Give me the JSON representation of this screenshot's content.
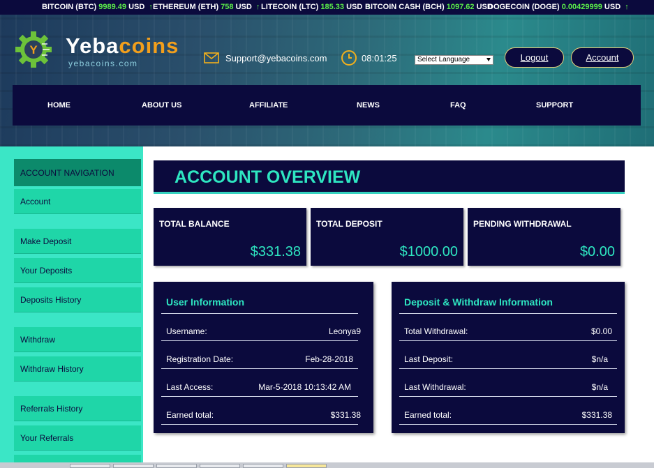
{
  "ticker": [
    {
      "label": "BITCOIN (BTC)",
      "price": "9989.49",
      "unit": "USD",
      "arrow": "↑"
    },
    {
      "label": "ETHEREUM (ETH)",
      "price": "758",
      "unit": "USD",
      "arrow": "↑"
    },
    {
      "label": "LITECOIN (LTC)",
      "price": "185.33",
      "unit": "USD",
      "arrow": "↑"
    },
    {
      "label": "BITCOIN CASH (BCH)",
      "price": "1097.62",
      "unit": "USD",
      "arrow": "↑"
    },
    {
      "label": "DOGECOIN (DOGE)",
      "price": "0.00429999",
      "unit": "USD",
      "arrow": "↑"
    }
  ],
  "header": {
    "logo_name_1": "Yeba",
    "logo_name_2": "coins",
    "logo_sub": "yebacoins.com",
    "support_email": "Support@yebacoins.com",
    "clock": "08:01:25",
    "language_select": "Select Language",
    "logout_label": "Logout",
    "account_label": "Account"
  },
  "nav": [
    "HOME",
    "ABOUT US",
    "AFFILIATE",
    "NEWS",
    "FAQ",
    "SUPPORT"
  ],
  "sidebar": {
    "heading": "ACCOUNT NAVIGATION",
    "items": [
      "Account",
      "Make Deposit",
      "Your Deposits",
      "Deposits History",
      "Withdraw",
      "Withdraw History",
      "Referrals History",
      "Your Referrals"
    ]
  },
  "main": {
    "title": "ACCOUNT OVERVIEW",
    "stats": [
      {
        "label": "TOTAL BALANCE",
        "value": "$331.38"
      },
      {
        "label": "TOTAL DEPOSIT",
        "value": "$1000.00"
      },
      {
        "label": "PENDING WITHDRAWAL",
        "value": "$0.00"
      }
    ],
    "user_info": {
      "title": "User Information",
      "rows": [
        {
          "k": "Username:",
          "v": "Leonya9"
        },
        {
          "k": "Registration Date:",
          "v": "Feb-28-2018"
        },
        {
          "k": "Last Access:",
          "v": "Mar-5-2018 10:13:42 AM"
        },
        {
          "k": "Earned total:",
          "v": "$331.38"
        }
      ]
    },
    "dw_info": {
      "title": "Deposit & Withdraw Information",
      "rows": [
        {
          "k": "Total Withdrawal:",
          "v": "$0.00"
        },
        {
          "k": "Last Deposit:",
          "v": "$n/a"
        },
        {
          "k": "Last Withdrawal:",
          "v": "$n/a"
        },
        {
          "k": "Earned total:",
          "v": "$331.38"
        }
      ]
    }
  },
  "colors": {
    "navy": "#0b0a3d",
    "accent": "#2ee6c1",
    "green": "#5cf04a",
    "orange": "#f29f1c"
  }
}
